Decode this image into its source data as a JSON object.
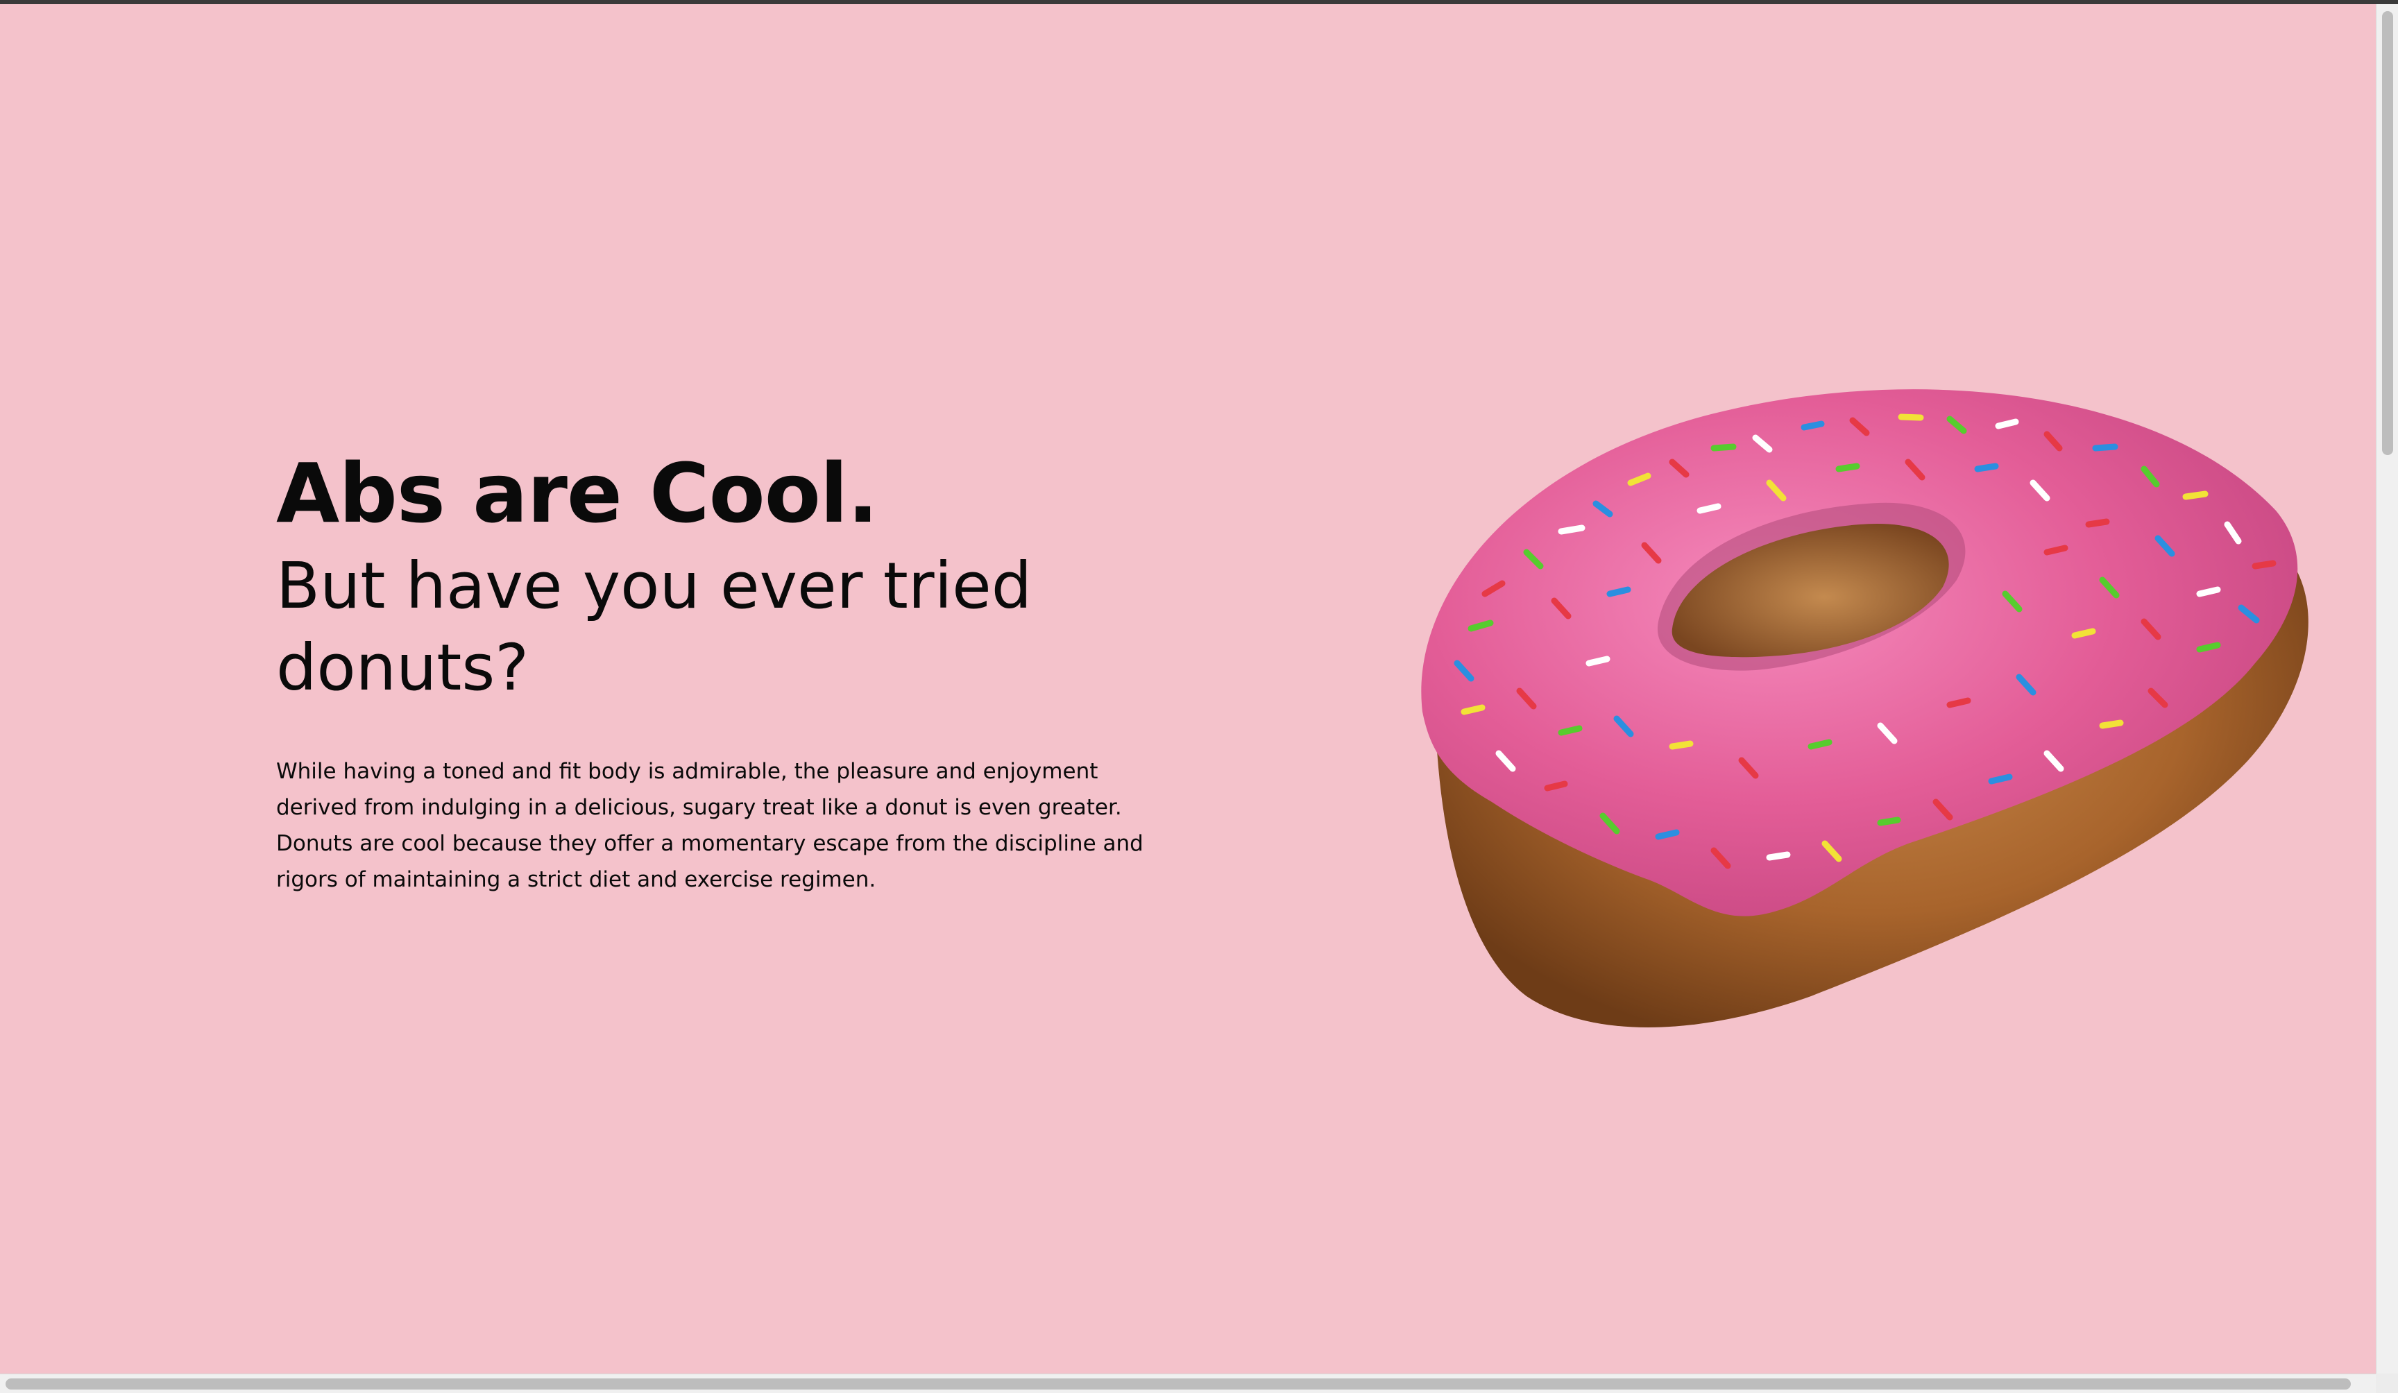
{
  "hero": {
    "headline": "Abs are Cool.",
    "subheadline": "But have you ever tried donuts?",
    "body": [
      "While having a toned and fit body is admirable, the pleasure and enjoyment derived from indulging in a delicious, sugary treat like a donut is even greater.",
      "Donuts are cool because they offer a momentary escape from the discipline and rigors of maintaining a strict diet and exercise regimen."
    ],
    "image": "pink-sprinkled-donut"
  },
  "colors": {
    "background": "#f4c2cb",
    "text": "#0a0a0a",
    "icing": "#e85d98",
    "dough": "#a8642c"
  }
}
